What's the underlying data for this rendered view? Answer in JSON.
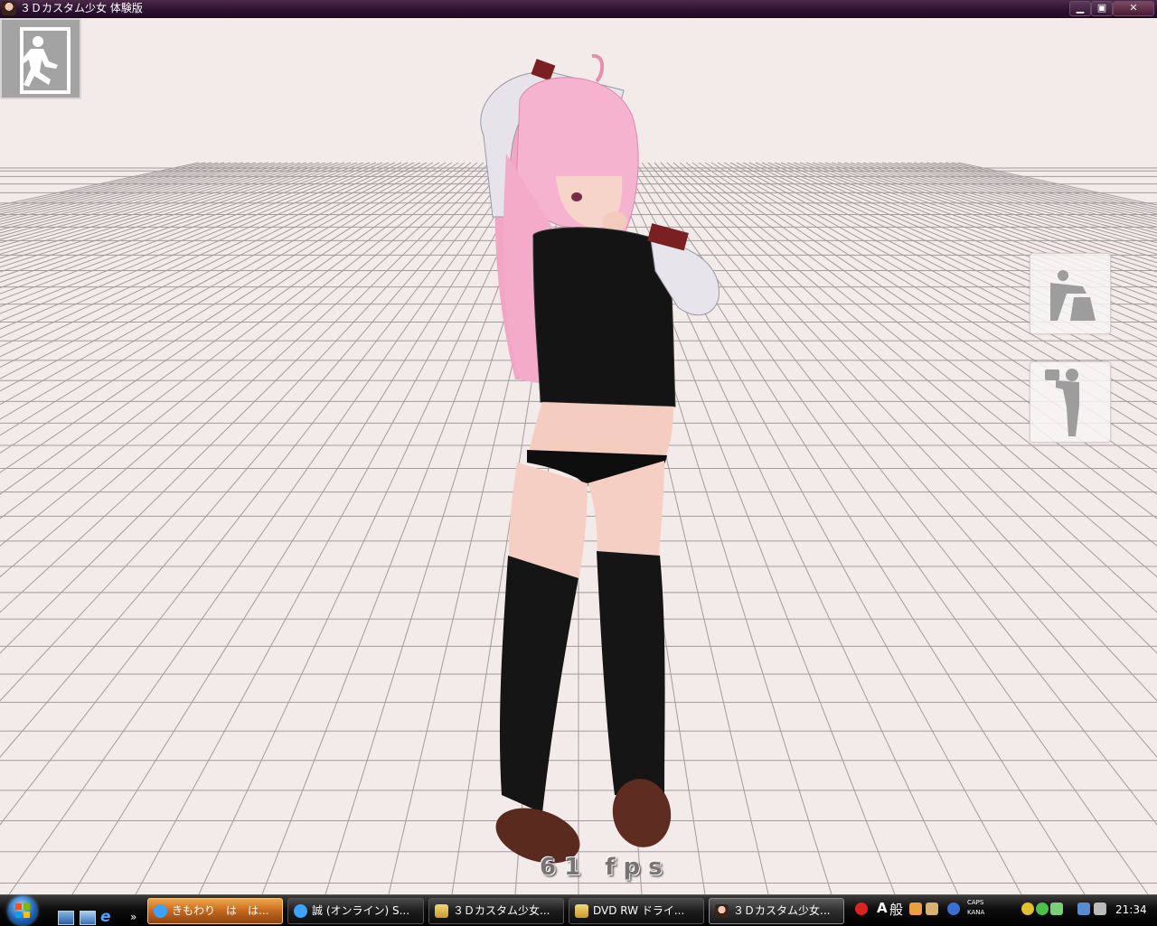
{
  "window": {
    "title": "３Ｄカスタム少女 体験版",
    "min_label": "▁",
    "max_label": "▣",
    "close_label": "✕"
  },
  "viewport": {
    "fps_text": "61 fps",
    "side_buttons": [
      {
        "name": "pose-bend",
        "icon": "bending-figure-icon"
      },
      {
        "name": "camera",
        "icon": "camera-person-icon"
      }
    ],
    "exit_icon": "exit-running-man-icon"
  },
  "taskbar": {
    "quicklaunch_more": "»",
    "tasks": [
      {
        "label": "きもわり　は　は...",
        "icon": "chat-icon",
        "active": false,
        "flashing": true
      },
      {
        "label": "誠 (オンライン) S...",
        "icon": "chat-icon",
        "active": false
      },
      {
        "label": "３Ｄカスタム少女...",
        "icon": "folder-icon",
        "active": false
      },
      {
        "label": "DVD RW ドライ...",
        "icon": "folder-icon",
        "active": false
      },
      {
        "label": "３Ｄカスタム少女...",
        "icon": "app-icon",
        "active": true
      }
    ],
    "tray": {
      "lang": "A",
      "ime": "般",
      "caps": "CAPS",
      "kana": "KANA",
      "clock": "21:34"
    }
  },
  "colors": {
    "floor": "#f3eaea",
    "grid": "#9a9494",
    "titlebar": "#2c1130",
    "active_task": "#c3681d"
  }
}
